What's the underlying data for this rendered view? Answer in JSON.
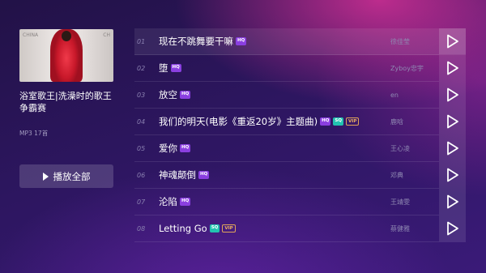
{
  "playlist": {
    "title": "浴室歌王|洗澡时的歌王争霸赛",
    "meta": "MP3  17首",
    "cover_text": {
      "left": "CHINA",
      "right": "CH"
    },
    "play_all_label": "播放全部"
  },
  "songs": [
    {
      "num": "01",
      "title": "现在不跳舞要干嘛",
      "badges": [
        "HQ"
      ],
      "artist": "徐佳莹"
    },
    {
      "num": "02",
      "title": "堕",
      "badges": [
        "HQ"
      ],
      "artist": "Zyboy忠宇"
    },
    {
      "num": "03",
      "title": "放空",
      "badges": [
        "HQ"
      ],
      "artist": "en"
    },
    {
      "num": "04",
      "title": "我们的明天(电影《重返20岁》主题曲)",
      "badges": [
        "HQ",
        "SQ",
        "VIP"
      ],
      "artist": "鹿晗"
    },
    {
      "num": "05",
      "title": "爱你",
      "badges": [
        "HQ"
      ],
      "artist": "王心凌"
    },
    {
      "num": "06",
      "title": "神魂颠倒",
      "badges": [
        "HQ"
      ],
      "artist": "邓典"
    },
    {
      "num": "07",
      "title": "沦陷",
      "badges": [
        "HQ"
      ],
      "artist": "王靖雯"
    },
    {
      "num": "08",
      "title": "Letting Go",
      "badges": [
        "SQ",
        "VIP"
      ],
      "artist": "蔡健雅"
    }
  ],
  "colors": {
    "hq": "#8a3fe0",
    "sq": "#22c3b0",
    "vip": "#e0a45a"
  },
  "icons": {
    "play": "play-triangle-icon"
  }
}
